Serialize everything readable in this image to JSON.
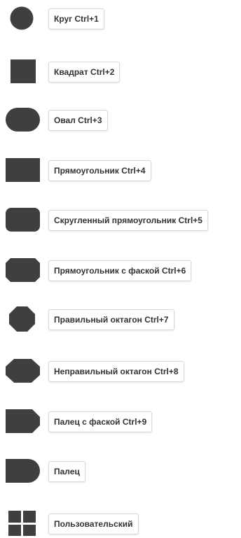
{
  "colors": {
    "shape_fill": "#3f3f3f",
    "tooltip_border": "#d9d9d9",
    "text": "#333333"
  },
  "items": [
    {
      "label": "Круг Ctrl+1",
      "icon": "circle-icon"
    },
    {
      "label": "Квадрат Ctrl+2",
      "icon": "square-icon"
    },
    {
      "label": "Овал Ctrl+3",
      "icon": "oval-icon"
    },
    {
      "label": "Прямоугольник Ctrl+4",
      "icon": "rectangle-icon"
    },
    {
      "label": "Скругленный прямоугольник Ctrl+5",
      "icon": "rounded-rectangle-icon"
    },
    {
      "label": "Прямоугольник с фаской Ctrl+6",
      "icon": "chamfered-rectangle-icon"
    },
    {
      "label": "Правильный октагон Ctrl+7",
      "icon": "regular-octagon-icon"
    },
    {
      "label": "Неправильный октагон Ctrl+8",
      "icon": "irregular-octagon-icon"
    },
    {
      "label": "Палец с фаской Ctrl+9",
      "icon": "chamfered-finger-icon"
    },
    {
      "label": "Палец",
      "icon": "finger-icon"
    },
    {
      "label": "Пользовательский",
      "icon": "custom-grid-icon"
    }
  ]
}
